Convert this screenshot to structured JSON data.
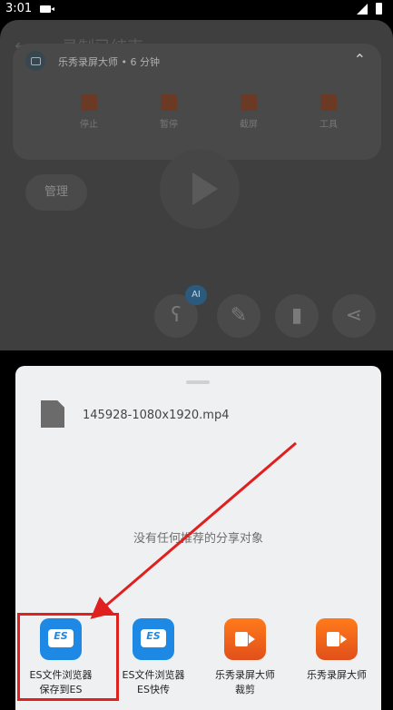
{
  "status": {
    "time": "3:01"
  },
  "background": {
    "title": "录制已结束",
    "notification": {
      "app_line": "乐秀录屏大师 • 6 分钟",
      "actions": [
        "停止",
        "暂停",
        "截屏",
        "工具"
      ]
    },
    "manage_label": "管理",
    "ai_badge": "AI"
  },
  "share_sheet": {
    "file_name": "145928-1080x1920.mp4",
    "empty_text": "没有任何推荐的分享对象",
    "targets": [
      {
        "line1": "ES文件浏览器",
        "line2": "保存到ES",
        "icon": "es-file-explorer-icon"
      },
      {
        "line1": "ES文件浏览器",
        "line2": "ES快传",
        "icon": "es-file-explorer-icon"
      },
      {
        "line1": "乐秀录屏大师",
        "line2": "裁剪",
        "icon": "lexiu-recorder-icon"
      },
      {
        "line1": "乐秀录屏大师",
        "line2": "",
        "icon": "lexiu-recorder-icon"
      }
    ]
  },
  "annotation": {
    "color": "#e0201f"
  }
}
